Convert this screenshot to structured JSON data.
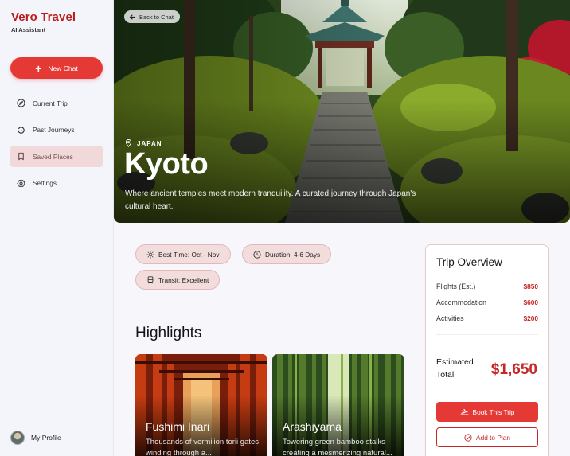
{
  "brand": {
    "title": "Vero Travel",
    "subtitle": "AI Assistant"
  },
  "sidebar": {
    "new_chat": "New Chat",
    "items": [
      {
        "label": "Current Trip",
        "icon": "compass-icon"
      },
      {
        "label": "Past Journeys",
        "icon": "history-icon"
      },
      {
        "label": "Saved Places",
        "icon": "bookmark-icon",
        "active": true
      },
      {
        "label": "Settings",
        "icon": "gear-icon"
      }
    ],
    "profile": "My Profile"
  },
  "hero": {
    "back": "Back to Chat",
    "location": "JAPAN",
    "title": "Kyoto",
    "description": "Where ancient temples meet modern tranquility. A curated journey through Japan's cultural heart."
  },
  "tags": [
    {
      "label": "Best Time: Oct - Nov",
      "icon": "sun-icon"
    },
    {
      "label": "Duration: 4-6 Days",
      "icon": "clock-icon"
    },
    {
      "label": "Transit: Excellent",
      "icon": "train-icon"
    }
  ],
  "highlights": {
    "heading": "Highlights",
    "cards": [
      {
        "title": "Fushimi Inari",
        "desc": "Thousands of vermilion torii gates winding through a..."
      },
      {
        "title": "Arashiyama",
        "desc": "Towering green bamboo stalks creating a mesmerizing natural..."
      }
    ]
  },
  "overview": {
    "title": "Trip Overview",
    "rows": [
      {
        "label": "Flights (Est.)",
        "amount": "$850"
      },
      {
        "label": "Accommodation",
        "amount": "$600"
      },
      {
        "label": "Activities",
        "amount": "$200"
      }
    ],
    "total_label": "Estimated Total",
    "total": "$1,650",
    "book": "Book This Trip",
    "add": "Add to Plan"
  },
  "colors": {
    "accent": "#e53935",
    "brand": "#b91c1c",
    "tag_bg": "#f3dcdc"
  }
}
